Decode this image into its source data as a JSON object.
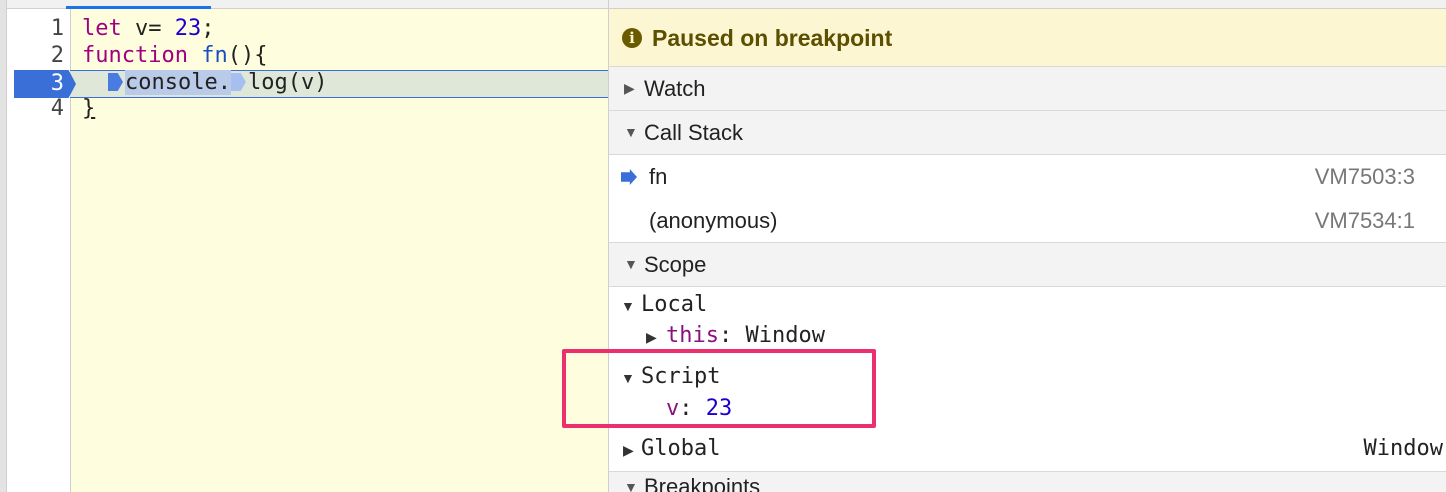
{
  "editor": {
    "lines": [
      {
        "num": "1",
        "parts": [
          {
            "t": "let",
            "c": "kw"
          },
          {
            "t": " v= ",
            "c": ""
          },
          {
            "t": "23",
            "c": "num"
          },
          {
            "t": ";",
            "c": ""
          }
        ]
      },
      {
        "num": "2",
        "parts": [
          {
            "t": "function",
            "c": "kw"
          },
          {
            "t": " ",
            "c": ""
          },
          {
            "t": "fn",
            "c": "fnname"
          },
          {
            "t": "(){",
            "c": ""
          }
        ]
      },
      {
        "num": "3",
        "current": true,
        "parts": [
          {
            "t": "console",
            "c": ""
          },
          {
            "t": ".",
            "c": ""
          },
          {
            "t": "log(v)",
            "c": ""
          }
        ]
      },
      {
        "num": "4",
        "parts": [
          {
            "t": "}",
            "c": ""
          }
        ]
      }
    ],
    "line1_kw": "let",
    "line1_var": " v= ",
    "line1_num": "23",
    "line1_end": ";",
    "line2_kw": "function",
    "line2_sp": " ",
    "line2_fn": "fn",
    "line2_end": "(){",
    "line3_obj": "console",
    "line3_dot": ".",
    "line3_call": "log(v)",
    "line4_code": "}",
    "current_line_num": "3"
  },
  "debugger": {
    "paused_message": "Paused on breakpoint",
    "paused_icon": "info-icon",
    "sections": {
      "watch": "Watch",
      "call_stack": "Call Stack",
      "scope": "Scope",
      "breakpoints": "Breakpoints"
    },
    "call_stack": [
      {
        "name": "fn",
        "location": "VM7503:3",
        "current": true
      },
      {
        "name": "(anonymous)",
        "location": "VM7534:1",
        "current": false
      }
    ],
    "scope": {
      "local_label": "Local",
      "this_key": "this",
      "this_sep": ": ",
      "this_value": "Window",
      "script_label": "Script",
      "v_key": "v",
      "v_sep": ": ",
      "v_value": "23",
      "global_label": "Global",
      "global_value": "Window"
    }
  },
  "colors": {
    "keyword": "#a1007f",
    "number": "#1c00cf",
    "execution_highlight": "#3a6fd8",
    "annotation_box": "#ec2f6d",
    "paused_banner": "#fdf6d3"
  }
}
